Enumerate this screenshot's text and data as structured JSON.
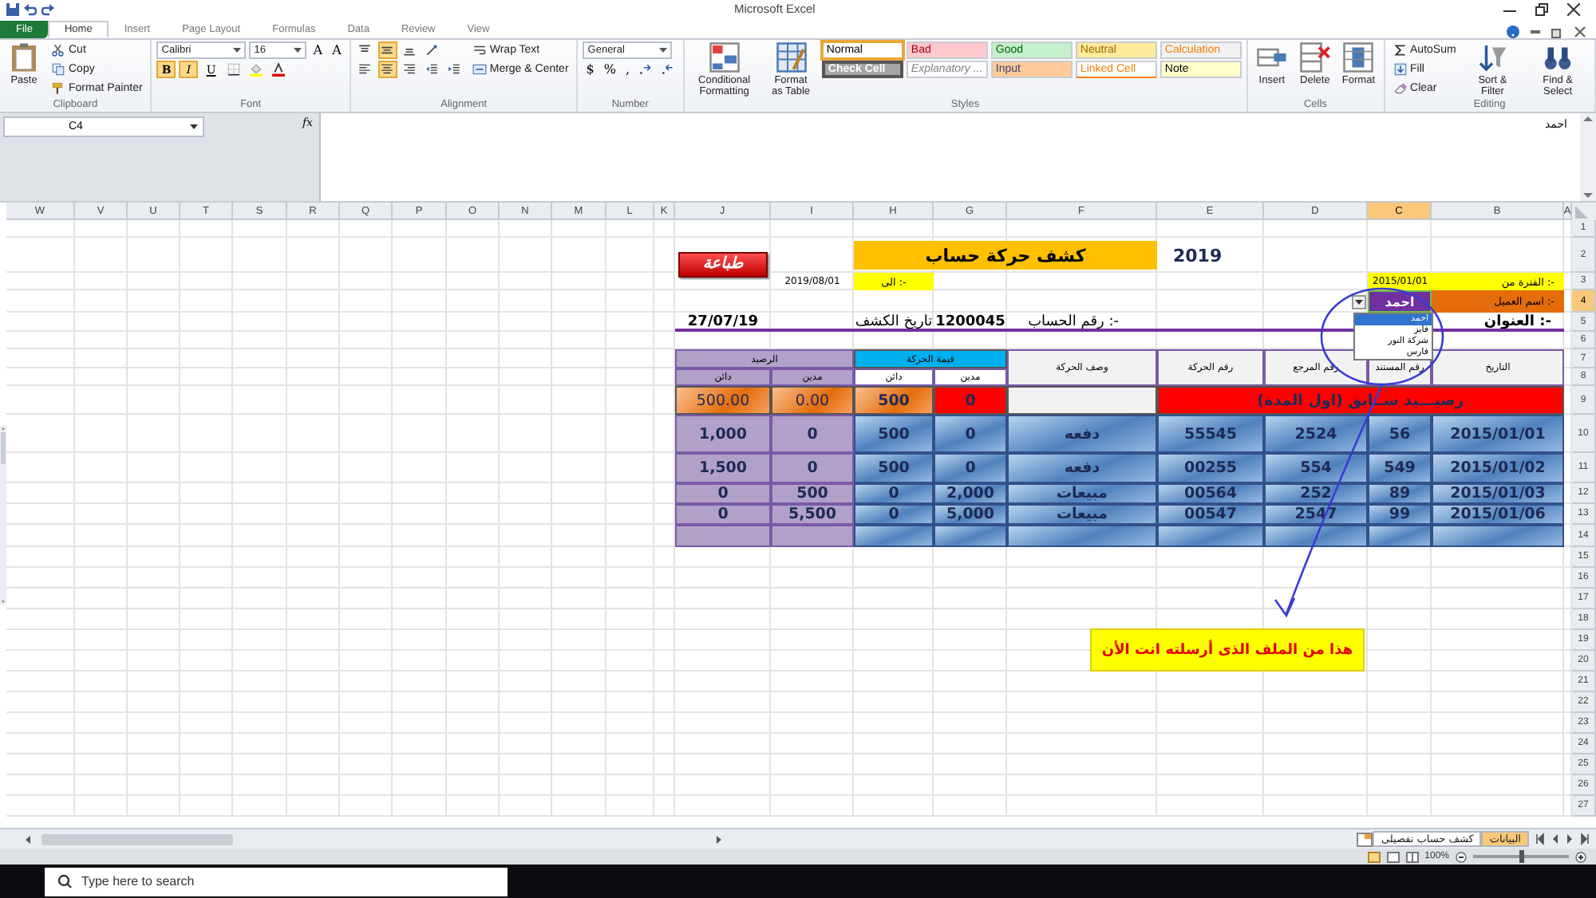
{
  "window": {
    "title": "Microsoft Excel"
  },
  "tabs": [
    {
      "label": "File",
      "selected": false
    },
    {
      "label": "Home",
      "selected": true
    },
    {
      "label": "Insert",
      "selected": false
    },
    {
      "label": "Page Layout",
      "selected": false
    },
    {
      "label": "Formulas",
      "selected": false
    },
    {
      "label": "Data",
      "selected": false
    },
    {
      "label": "Review",
      "selected": false
    },
    {
      "label": "View",
      "selected": false
    }
  ],
  "ribbon": {
    "groups": [
      {
        "label": "Clipboard",
        "items": [
          {
            "kind": "large",
            "label": "Paste"
          },
          {
            "kind": "stack",
            "rows": [
              {
                "items": [
                  {
                    "kind": "small",
                    "label": "Cut"
                  }
                ]
              },
              {
                "items": [
                  {
                    "kind": "small",
                    "label": "Copy"
                  }
                ]
              },
              {
                "items": [
                  {
                    "kind": "small",
                    "label": "Format Painter"
                  }
                ]
              }
            ]
          }
        ]
      },
      {
        "label": "Font",
        "items": [
          {
            "kind": "stack",
            "rows": [
              {
                "items": [
                  {
                    "kind": "combo",
                    "value": "Calibri"
                  },
                  {
                    "kind": "combo",
                    "value": "16"
                  },
                  {
                    "kind": "glyph",
                    "label": "A"
                  },
                  {
                    "kind": "glyph",
                    "label": "A"
                  }
                ]
              },
              {
                "items": [
                  {
                    "kind": "toggle",
                    "label": "B",
                    "on": true
                  },
                  {
                    "kind": "toggle",
                    "label": "I",
                    "on": true
                  },
                  {
                    "kind": "toggle",
                    "label": "U",
                    "on": false
                  },
                  {
                    "kind": "tool",
                    "on": false
                  },
                  {
                    "kind": "tool",
                    "on": false
                  },
                  {
                    "kind": "tool",
                    "on": false
                  }
                ]
              }
            ]
          }
        ]
      },
      {
        "label": "Alignment",
        "items": [
          {
            "kind": "stack",
            "rows": [
              {
                "items": [
                  {
                    "kind": "tool",
                    "on": false
                  },
                  {
                    "kind": "tool",
                    "on": true
                  },
                  {
                    "kind": "tool",
                    "on": false
                  },
                  {
                    "kind": "tool",
                    "on": false
                  }
                ]
              },
              {
                "items": [
                  {
                    "kind": "tool",
                    "on": false
                  },
                  {
                    "kind": "tool",
                    "on": true
                  },
                  {
                    "kind": "tool",
                    "on": false
                  },
                  {
                    "kind": "tool",
                    "on": false
                  },
                  {
                    "kind": "tool",
                    "on": false
                  }
                ]
              }
            ]
          },
          {
            "kind": "stack",
            "rows": [
              {
                "items": [
                  {
                    "kind": "small",
                    "label": "Wrap Text"
                  }
                ]
              },
              {
                "items": [
                  {
                    "kind": "small",
                    "label": "Merge & Center"
                  }
                ]
              }
            ]
          }
        ]
      },
      {
        "label": "Number",
        "items": [
          {
            "kind": "stack",
            "rows": [
              {
                "items": [
                  {
                    "kind": "combo",
                    "value": "General"
                  }
                ]
              },
              {
                "items": [
                  {
                    "kind": "glyph",
                    "label": "$"
                  },
                  {
                    "kind": "glyph",
                    "label": "%"
                  },
                  {
                    "kind": "glyph",
                    "label": ","
                  },
                  {
                    "kind": "tool",
                    "on": false
                  },
                  {
                    "kind": "tool",
                    "on": false
                  }
                ]
              }
            ]
          }
        ]
      },
      {
        "label": "Styles",
        "items": [
          {
            "kind": "large",
            "label": "Conditional Formatting"
          },
          {
            "kind": "large",
            "label": "Format as Table"
          },
          {
            "kind": "stack",
            "rows": [
              {
                "items": [
                  {
                    "kind": "style",
                    "label": "Normal",
                    "color": "#ffffff",
                    "selected": true
                  },
                  {
                    "kind": "style",
                    "label": "Bad",
                    "color": "#ffc7ce",
                    "selected": false
                  },
                  {
                    "kind": "style",
                    "label": "Good",
                    "color": "#c6efce",
                    "selected": false
                  },
                  {
                    "kind": "style",
                    "label": "Neutral",
                    "color": "#ffeb9c",
                    "selected": false
                  },
                  {
                    "kind": "style",
                    "label": "Calculation",
                    "color": "#f2f2f2",
                    "selected": false
                  }
                ]
              },
              {
                "items": [
                  {
                    "kind": "style",
                    "label": "Check Cell",
                    "color": "#a5a5a5",
                    "selected": false
                  },
                  {
                    "kind": "style",
                    "label": "Explanatory ...",
                    "color": "#ffffff",
                    "selected": false
                  },
                  {
                    "kind": "style",
                    "label": "Input",
                    "color": "#ffcc99",
                    "selected": false
                  },
                  {
                    "kind": "style",
                    "label": "Linked Cell",
                    "color": "#ffffff",
                    "selected": false
                  },
                  {
                    "kind": "style",
                    "label": "Note",
                    "color": "#ffffcc",
                    "selected": false
                  }
                ]
              }
            ]
          }
        ]
      },
      {
        "label": "Cells",
        "items": [
          {
            "kind": "large",
            "label": "Insert"
          },
          {
            "kind": "large",
            "label": "Delete"
          },
          {
            "kind": "large",
            "label": "Format"
          }
        ]
      },
      {
        "label": "Editing",
        "items": [
          {
            "kind": "stack",
            "rows": [
              {
                "items": [
                  {
                    "kind": "small",
                    "label": "AutoSum"
                  }
                ]
              },
              {
                "items": [
                  {
                    "kind": "small",
                    "label": "Fill"
                  }
                ]
              },
              {
                "items": [
                  {
                    "kind": "small",
                    "label": "Clear"
                  }
                ]
              }
            ]
          },
          {
            "kind": "large",
            "label": "Sort & Filter"
          },
          {
            "kind": "large",
            "label": "Find & Select"
          }
        ]
      }
    ]
  },
  "formula_bar": {
    "name_box": "C4",
    "function_button": "fx",
    "value": "احمد"
  },
  "sheet": {
    "columns": [
      {
        "label": "W",
        "selected": false
      },
      {
        "label": "V",
        "selected": false
      },
      {
        "label": "U",
        "selected": false
      },
      {
        "label": "T",
        "selected": false
      },
      {
        "label": "S",
        "selected": false
      },
      {
        "label": "R",
        "selected": false
      },
      {
        "label": "Q",
        "selected": false
      },
      {
        "label": "P",
        "selected": false
      },
      {
        "label": "O",
        "selected": false
      },
      {
        "label": "N",
        "selected": false
      },
      {
        "label": "M",
        "selected": false
      },
      {
        "label": "L",
        "selected": false
      },
      {
        "label": "K",
        "selected": false
      },
      {
        "label": "J",
        "selected": false
      },
      {
        "label": "I",
        "selected": false
      },
      {
        "label": "H",
        "selected": false
      },
      {
        "label": "G",
        "selected": false
      },
      {
        "label": "F",
        "selected": false
      },
      {
        "label": "E",
        "selected": false
      },
      {
        "label": "D",
        "selected": false
      },
      {
        "label": "C",
        "selected": true
      },
      {
        "label": "B",
        "selected": false
      },
      {
        "label": "A",
        "selected": false
      }
    ],
    "rows": [
      {
        "label": "1",
        "selected": false
      },
      {
        "label": "2",
        "selected": false
      },
      {
        "label": "3",
        "selected": false
      },
      {
        "label": "4",
        "selected": true
      },
      {
        "label": "5",
        "selected": false
      },
      {
        "label": "6",
        "selected": false
      },
      {
        "label": "7",
        "selected": false
      },
      {
        "label": "8",
        "selected": false
      },
      {
        "label": "9",
        "selected": false
      },
      {
        "label": "10",
        "selected": false
      },
      {
        "label": "11",
        "selected": false
      },
      {
        "label": "12",
        "selected": false
      },
      {
        "label": "13",
        "selected": false
      },
      {
        "label": "14",
        "selected": false
      },
      {
        "label": "15",
        "selected": false
      },
      {
        "label": "16",
        "selected": false
      },
      {
        "label": "17",
        "selected": false
      },
      {
        "label": "18",
        "selected": false
      },
      {
        "label": "19",
        "selected": false
      },
      {
        "label": "20",
        "selected": false
      },
      {
        "label": "21",
        "selected": false
      },
      {
        "label": "22",
        "selected": false
      },
      {
        "label": "23",
        "selected": false
      },
      {
        "label": "24",
        "selected": false
      },
      {
        "label": "25",
        "selected": false
      },
      {
        "label": "26",
        "selected": false
      },
      {
        "label": "27",
        "selected": false
      }
    ]
  },
  "statement": {
    "print_button": "طباعة",
    "title": "كشف حركة حساب",
    "year": "2019",
    "period_from_label": "الفترة من :-",
    "period_from": "2015/01/01",
    "period_to_label": "الى :-",
    "period_to": "2019/08/01",
    "customer_label": "اسم العميل :-",
    "customer": "احمد",
    "customer_options": [
      {
        "label": "احمد",
        "selected": true
      },
      {
        "label": "فايز",
        "selected": false
      },
      {
        "label": "شركة النور",
        "selected": false
      },
      {
        "label": "فارس",
        "selected": false
      }
    ],
    "address_label": "العنوان :-",
    "account_label": "رقم الحساب :-",
    "account": "1200045",
    "statement_date_label": "تاريخ الكشف",
    "statement_date": "27/07/19",
    "headers": {
      "date": "التاريخ",
      "document": "رقم المستند",
      "reference": "رقم المرجع",
      "movement": "رقم الحركة",
      "description": "وصف الحركة",
      "amount": "قيمة الحركة",
      "amount_debit": "مدين",
      "amount_credit": "دائن",
      "balance": "الرصيد",
      "balance_debit": "مدين",
      "balance_credit": "دائن"
    },
    "opening": {
      "label": "رصيـــيد ســابق (اول المدة)",
      "debit": "0",
      "credit": "500",
      "balance_debit": "0.00",
      "balance_credit": "500.00"
    },
    "rows": [
      {
        "date": "2015/01/01",
        "document": "56",
        "reference": "2524",
        "movement": "55545",
        "description": "دفعه",
        "debit": "0",
        "credit": "500",
        "balance_debit": "0",
        "balance_credit": "1,000"
      },
      {
        "date": "2015/01/02",
        "document": "549",
        "reference": "554",
        "movement": "00255",
        "description": "دفعه",
        "debit": "0",
        "credit": "500",
        "balance_debit": "0",
        "balance_credit": "1,500"
      },
      {
        "date": "2015/01/03",
        "document": "89",
        "reference": "252",
        "movement": "00564",
        "description": "مبيعات",
        "debit": "2,000",
        "credit": "0",
        "balance_debit": "500",
        "balance_credit": "0"
      },
      {
        "date": "2015/01/06",
        "document": "99",
        "reference": "2547",
        "movement": "00547",
        "description": "مبيعات",
        "debit": "5,000",
        "credit": "0",
        "balance_debit": "5,500",
        "balance_credit": "0"
      }
    ]
  },
  "annotation": {
    "note": "هذا من الملف الذى أرسلته انت الأن"
  },
  "sheet_tabs": [
    {
      "label": "البيانات",
      "selected": true
    },
    {
      "label": "كشف حساب تفصيلى",
      "selected": false
    }
  ],
  "status_bar": {
    "zoom": "100%",
    "zoom_slider": {
      "level": 0.5
    }
  },
  "taskbar": {
    "search": {
      "placeholder": "Type here to search"
    }
  }
}
